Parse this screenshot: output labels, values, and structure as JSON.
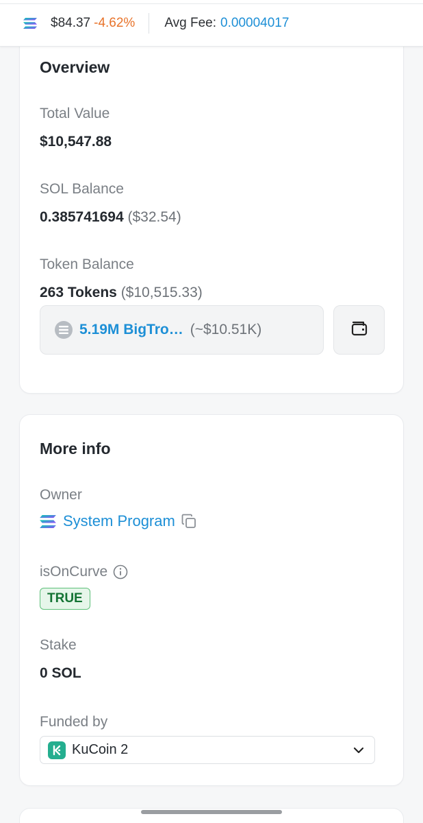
{
  "topbar": {
    "price": "$84.37",
    "change": "-4.62%",
    "fee_label": "Avg Fee:",
    "fee_value": "0.00004017"
  },
  "overview": {
    "title": "Overview",
    "total_value_label": "Total Value",
    "total_value": "$10,547.88",
    "sol_balance_label": "SOL Balance",
    "sol_balance": "0.385741694",
    "sol_balance_usd": "($32.54)",
    "token_balance_label": "Token Balance",
    "token_balance": "263 Tokens",
    "token_balance_usd": "($10,515.33)",
    "top_token_name": "5.19M BigTro…",
    "top_token_value": "(~$10.51K)"
  },
  "more_info": {
    "title": "More info",
    "owner_label": "Owner",
    "owner_value": "System Program",
    "curve_label": "isOnCurve",
    "curve_value": "TRUE",
    "stake_label": "Stake",
    "stake_value": "0 SOL",
    "funded_label": "Funded by",
    "funded_value": "KuCoin 2"
  },
  "colors": {
    "link": "#1d8fd6",
    "negative": "#e8732a",
    "badge_green": "#137333"
  },
  "icons": [
    "solana-logo-icon",
    "token-icon",
    "wallet-icon",
    "copy-icon",
    "info-icon",
    "kucoin-logo-icon",
    "chevron-down-icon"
  ]
}
